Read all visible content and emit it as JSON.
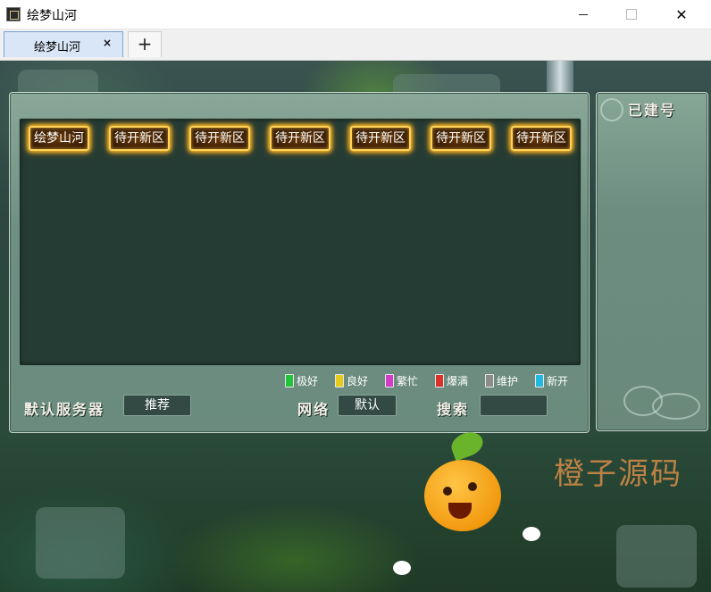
{
  "window": {
    "title": "绘梦山河",
    "minimize": "—",
    "close": "✕"
  },
  "tabs": {
    "active_label": "绘梦山河",
    "close_glyph": "×",
    "add_glyph": "+"
  },
  "server_list": {
    "servers": [
      "绘梦山河",
      "待开新区",
      "待开新区",
      "待开新区",
      "待开新区",
      "待开新区",
      "待开新区"
    ]
  },
  "legend": [
    {
      "label": "极好",
      "color": "#22c43a"
    },
    {
      "label": "良好",
      "color": "#e6cc1a"
    },
    {
      "label": "繁忙",
      "color": "#d23cc8"
    },
    {
      "label": "爆满",
      "color": "#d8322a"
    },
    {
      "label": "维护",
      "color": "#8c8c8c"
    },
    {
      "label": "新开",
      "color": "#22b8e0"
    }
  ],
  "bottom": {
    "default_server_label": "默认服务器",
    "default_server_value": "推荐",
    "network_label": "网络",
    "network_value": "默认",
    "search_label": "搜索",
    "search_value": ""
  },
  "side_panel": {
    "title": "已建号"
  },
  "watermark": {
    "text": "橙子源码"
  }
}
